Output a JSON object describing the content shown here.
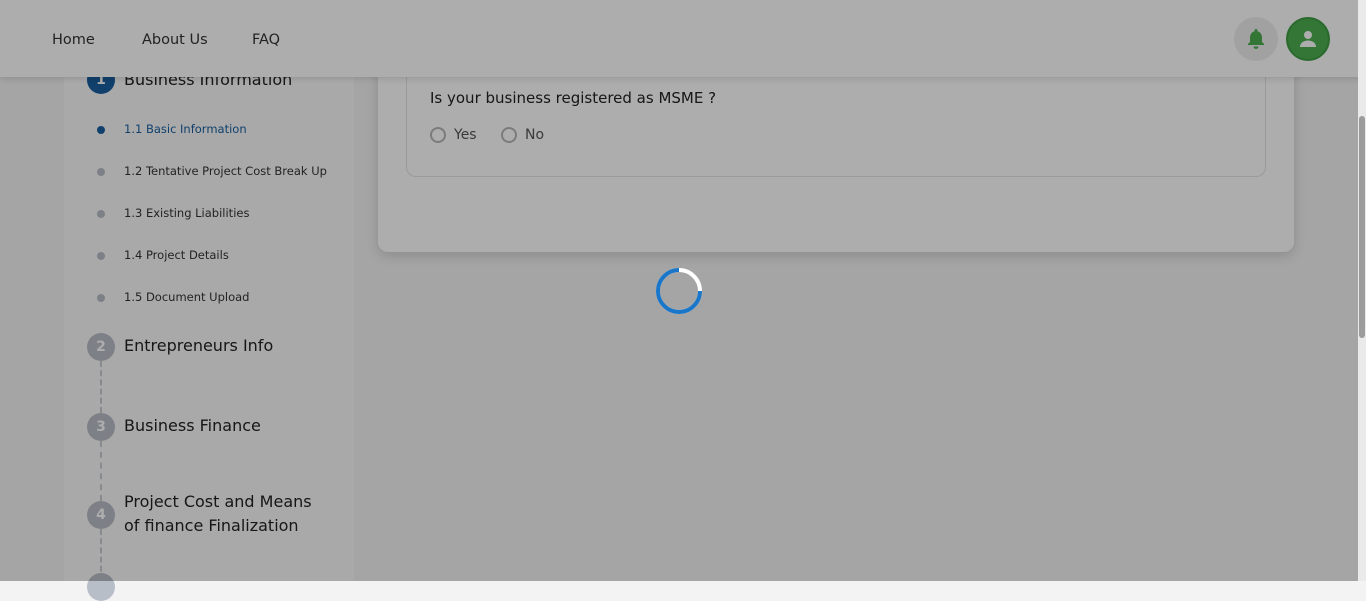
{
  "header": {
    "nav": [
      "Home",
      "About Us",
      "FAQ"
    ],
    "icons": {
      "notifications": "bell-icon",
      "profile": "user-icon"
    },
    "colors": {
      "bell": "#4caf50",
      "avatar_bg": "#4caf50"
    }
  },
  "sidebar": {
    "steps": [
      {
        "number": "1",
        "title": "Business Information",
        "active": true
      },
      {
        "number": "2",
        "title": "Entrepreneurs Info"
      },
      {
        "number": "3",
        "title": "Business Finance"
      },
      {
        "number": "4",
        "title_line1": "Project Cost and Means",
        "title_line2": "of finance Finalization"
      }
    ],
    "substeps": [
      "1.1 Basic Information",
      "1.2 Tentative Project Cost Break Up",
      "1.3 Existing Liabilities",
      "1.4 Project Details",
      "1.5 Document Upload"
    ],
    "active_color": "#1a5fa0"
  },
  "form": {
    "question": "Is your business registered as MSME ?",
    "options": [
      "Yes",
      "No"
    ]
  },
  "loading": {
    "spinner_color": "#1a76c9"
  }
}
